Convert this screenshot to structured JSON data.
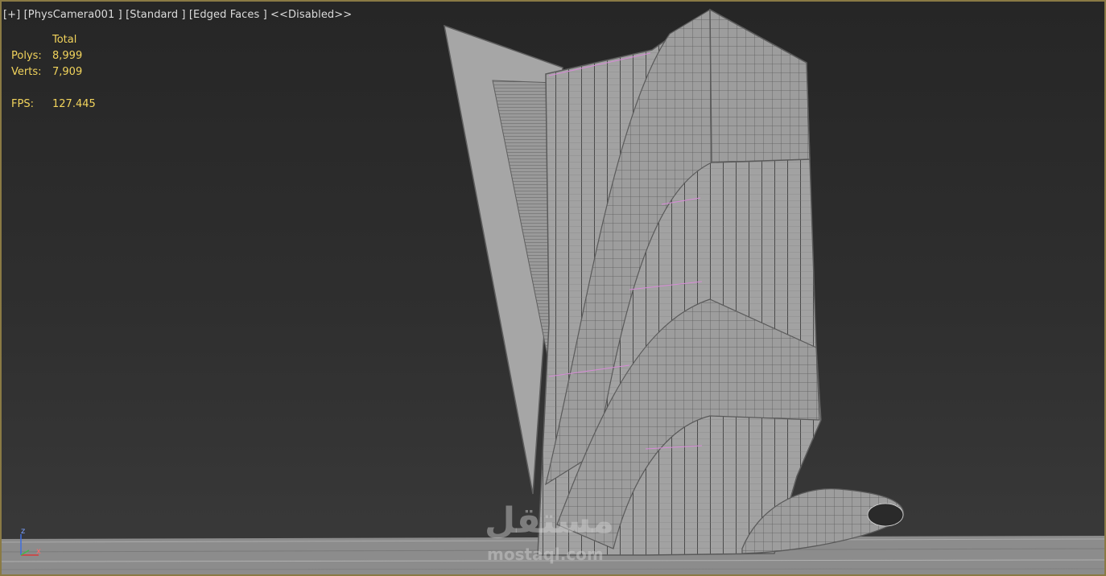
{
  "viewport": {
    "label_plus": "[+]",
    "label_camera": "[PhysCamera001 ]",
    "label_shading": "[Standard ]",
    "label_edges": "[Edged Faces ]",
    "label_disabled": "<<Disabled>>"
  },
  "stats": {
    "header": "Total",
    "polys_label": "Polys:",
    "polys_value": "8,999",
    "verts_label": "Verts:",
    "verts_value": "7,909",
    "fps_label": "FPS:",
    "fps_value": "127.445"
  },
  "axis": {
    "z": "z",
    "x": "x"
  },
  "watermark": {
    "arabic": "مستقل",
    "latin": "mostaql.com"
  },
  "colors": {
    "stats_text": "#f2d45c",
    "label_text": "#dcdcdc",
    "mesh": "#9a9a9a",
    "edge": "#555555",
    "border": "#8a7a44"
  }
}
